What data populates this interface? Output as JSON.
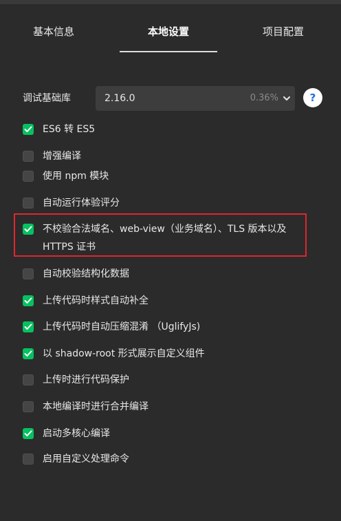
{
  "tabs": [
    {
      "label": "基本信息",
      "active": false
    },
    {
      "label": "本地设置",
      "active": true
    },
    {
      "label": "项目配置",
      "active": false
    }
  ],
  "base_library": {
    "label": "调试基础库",
    "version": "2.16.0",
    "percent": "0.36%",
    "help": "?"
  },
  "options": [
    {
      "label": "ES6 转 ES5",
      "checked": true
    },
    {
      "label": "增强编译",
      "checked": false
    },
    {
      "label": "使用 npm 模块",
      "checked": false
    },
    {
      "label": "自动运行体验评分",
      "checked": false
    },
    {
      "label": "不校验合法域名、web-view（业务域名）、TLS 版本以及 HTTPS 证书",
      "checked": true,
      "highlighted": true
    },
    {
      "label": "自动校验结构化数据",
      "checked": false
    },
    {
      "label": "上传代码时样式自动补全",
      "checked": true
    },
    {
      "label": "上传代码时自动压缩混淆 （UglifyJs)",
      "checked": true
    },
    {
      "label": "以 shadow-root 形式展示自定义组件",
      "checked": true
    },
    {
      "label": "上传时进行代码保护",
      "checked": false
    },
    {
      "label": "本地编译时进行合并编译",
      "checked": false
    },
    {
      "label": "启动多核心编译",
      "checked": true
    },
    {
      "label": "启用自定义处理命令",
      "checked": false
    }
  ],
  "colors": {
    "background": "#2b2b2b",
    "checked": "#07c160",
    "highlight_border": "#e0262f",
    "help_icon": "#1f6fde"
  }
}
